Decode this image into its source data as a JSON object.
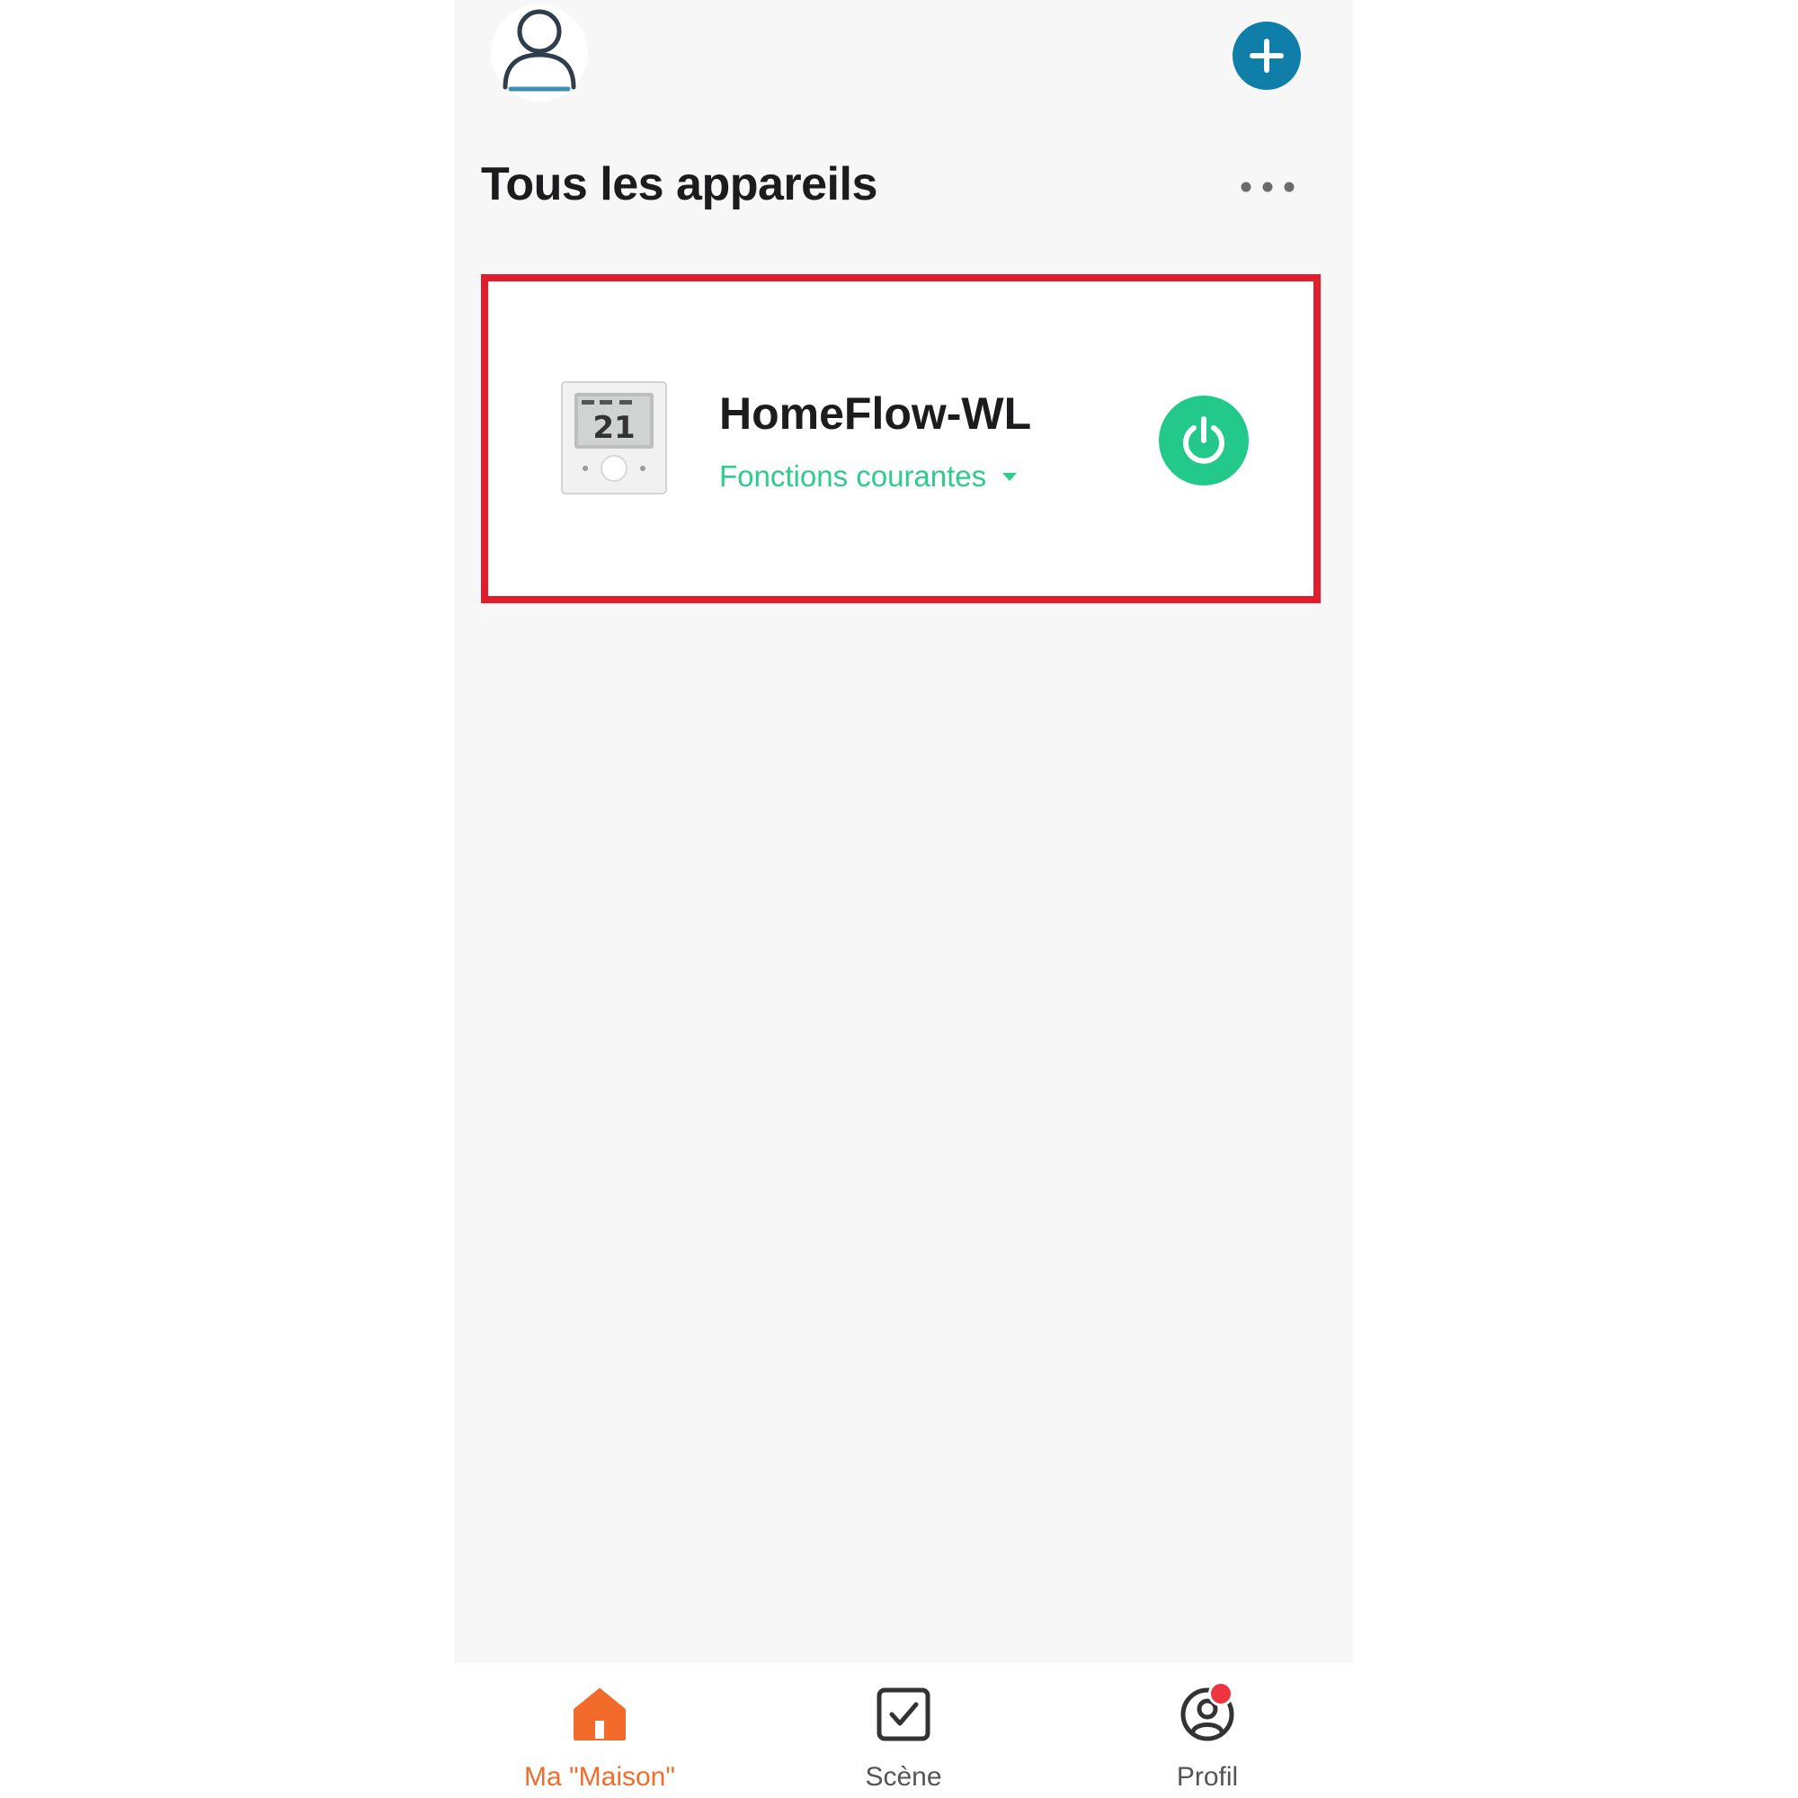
{
  "header": {
    "title": "Tous les appareils"
  },
  "device": {
    "name": "HomeFlow-WL",
    "functions_label": "Fonctions courantes",
    "thermostat_display": "21",
    "power_state": "on"
  },
  "tabbar": {
    "tabs": [
      {
        "label": "Ma \"Maison\"",
        "icon": "home-icon",
        "active": true
      },
      {
        "label": "Scène",
        "icon": "checkbox-icon",
        "active": false
      },
      {
        "label": "Profil",
        "icon": "profile-icon",
        "active": false,
        "badge": true
      }
    ]
  },
  "colors": {
    "accent_blue": "#0f7ea8",
    "accent_green": "#22c98a",
    "function_green": "#2dcc8c",
    "active_tab": "#f26b2a",
    "inactive_tab": "#555555",
    "highlight_red": "#e11d2b",
    "badge_red": "#ef3340"
  }
}
